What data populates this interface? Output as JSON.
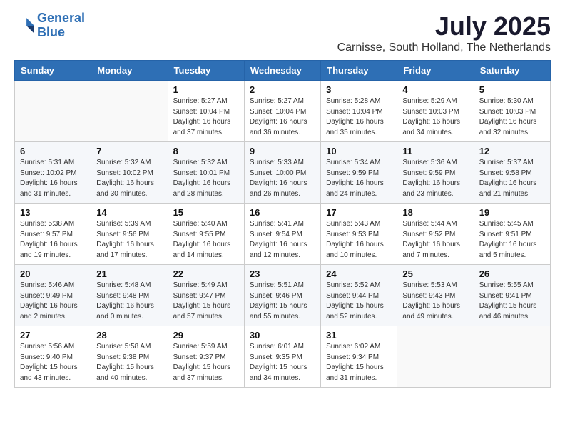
{
  "logo": {
    "line1": "General",
    "line2": "Blue"
  },
  "title": "July 2025",
  "location": "Carnisse, South Holland, The Netherlands",
  "days_of_week": [
    "Sunday",
    "Monday",
    "Tuesday",
    "Wednesday",
    "Thursday",
    "Friday",
    "Saturday"
  ],
  "weeks": [
    [
      {
        "day": "",
        "info": ""
      },
      {
        "day": "",
        "info": ""
      },
      {
        "day": "1",
        "info": "Sunrise: 5:27 AM\nSunset: 10:04 PM\nDaylight: 16 hours\nand 37 minutes."
      },
      {
        "day": "2",
        "info": "Sunrise: 5:27 AM\nSunset: 10:04 PM\nDaylight: 16 hours\nand 36 minutes."
      },
      {
        "day": "3",
        "info": "Sunrise: 5:28 AM\nSunset: 10:04 PM\nDaylight: 16 hours\nand 35 minutes."
      },
      {
        "day": "4",
        "info": "Sunrise: 5:29 AM\nSunset: 10:03 PM\nDaylight: 16 hours\nand 34 minutes."
      },
      {
        "day": "5",
        "info": "Sunrise: 5:30 AM\nSunset: 10:03 PM\nDaylight: 16 hours\nand 32 minutes."
      }
    ],
    [
      {
        "day": "6",
        "info": "Sunrise: 5:31 AM\nSunset: 10:02 PM\nDaylight: 16 hours\nand 31 minutes."
      },
      {
        "day": "7",
        "info": "Sunrise: 5:32 AM\nSunset: 10:02 PM\nDaylight: 16 hours\nand 30 minutes."
      },
      {
        "day": "8",
        "info": "Sunrise: 5:32 AM\nSunset: 10:01 PM\nDaylight: 16 hours\nand 28 minutes."
      },
      {
        "day": "9",
        "info": "Sunrise: 5:33 AM\nSunset: 10:00 PM\nDaylight: 16 hours\nand 26 minutes."
      },
      {
        "day": "10",
        "info": "Sunrise: 5:34 AM\nSunset: 9:59 PM\nDaylight: 16 hours\nand 24 minutes."
      },
      {
        "day": "11",
        "info": "Sunrise: 5:36 AM\nSunset: 9:59 PM\nDaylight: 16 hours\nand 23 minutes."
      },
      {
        "day": "12",
        "info": "Sunrise: 5:37 AM\nSunset: 9:58 PM\nDaylight: 16 hours\nand 21 minutes."
      }
    ],
    [
      {
        "day": "13",
        "info": "Sunrise: 5:38 AM\nSunset: 9:57 PM\nDaylight: 16 hours\nand 19 minutes."
      },
      {
        "day": "14",
        "info": "Sunrise: 5:39 AM\nSunset: 9:56 PM\nDaylight: 16 hours\nand 17 minutes."
      },
      {
        "day": "15",
        "info": "Sunrise: 5:40 AM\nSunset: 9:55 PM\nDaylight: 16 hours\nand 14 minutes."
      },
      {
        "day": "16",
        "info": "Sunrise: 5:41 AM\nSunset: 9:54 PM\nDaylight: 16 hours\nand 12 minutes."
      },
      {
        "day": "17",
        "info": "Sunrise: 5:43 AM\nSunset: 9:53 PM\nDaylight: 16 hours\nand 10 minutes."
      },
      {
        "day": "18",
        "info": "Sunrise: 5:44 AM\nSunset: 9:52 PM\nDaylight: 16 hours\nand 7 minutes."
      },
      {
        "day": "19",
        "info": "Sunrise: 5:45 AM\nSunset: 9:51 PM\nDaylight: 16 hours\nand 5 minutes."
      }
    ],
    [
      {
        "day": "20",
        "info": "Sunrise: 5:46 AM\nSunset: 9:49 PM\nDaylight: 16 hours\nand 2 minutes."
      },
      {
        "day": "21",
        "info": "Sunrise: 5:48 AM\nSunset: 9:48 PM\nDaylight: 16 hours\nand 0 minutes."
      },
      {
        "day": "22",
        "info": "Sunrise: 5:49 AM\nSunset: 9:47 PM\nDaylight: 15 hours\nand 57 minutes."
      },
      {
        "day": "23",
        "info": "Sunrise: 5:51 AM\nSunset: 9:46 PM\nDaylight: 15 hours\nand 55 minutes."
      },
      {
        "day": "24",
        "info": "Sunrise: 5:52 AM\nSunset: 9:44 PM\nDaylight: 15 hours\nand 52 minutes."
      },
      {
        "day": "25",
        "info": "Sunrise: 5:53 AM\nSunset: 9:43 PM\nDaylight: 15 hours\nand 49 minutes."
      },
      {
        "day": "26",
        "info": "Sunrise: 5:55 AM\nSunset: 9:41 PM\nDaylight: 15 hours\nand 46 minutes."
      }
    ],
    [
      {
        "day": "27",
        "info": "Sunrise: 5:56 AM\nSunset: 9:40 PM\nDaylight: 15 hours\nand 43 minutes."
      },
      {
        "day": "28",
        "info": "Sunrise: 5:58 AM\nSunset: 9:38 PM\nDaylight: 15 hours\nand 40 minutes."
      },
      {
        "day": "29",
        "info": "Sunrise: 5:59 AM\nSunset: 9:37 PM\nDaylight: 15 hours\nand 37 minutes."
      },
      {
        "day": "30",
        "info": "Sunrise: 6:01 AM\nSunset: 9:35 PM\nDaylight: 15 hours\nand 34 minutes."
      },
      {
        "day": "31",
        "info": "Sunrise: 6:02 AM\nSunset: 9:34 PM\nDaylight: 15 hours\nand 31 minutes."
      },
      {
        "day": "",
        "info": ""
      },
      {
        "day": "",
        "info": ""
      }
    ]
  ]
}
